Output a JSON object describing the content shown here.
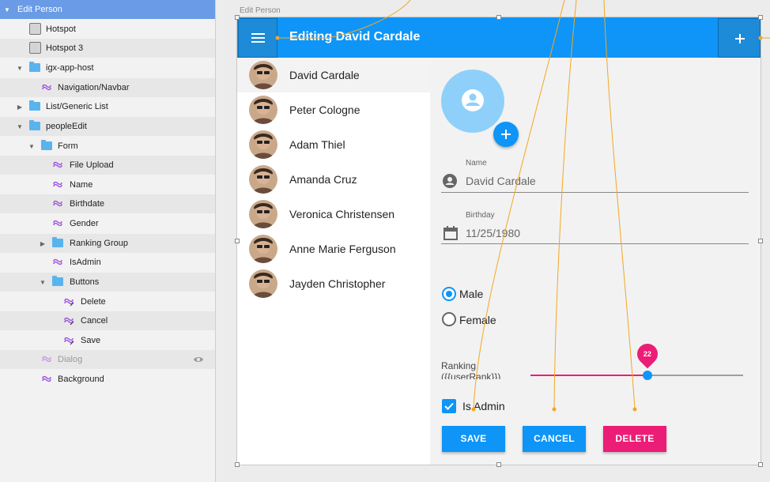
{
  "layers": {
    "items": [
      {
        "label": "Edit Person",
        "kind": "artboard",
        "indent": 0,
        "expanded": true,
        "selected": true
      },
      {
        "label": "Hotspot",
        "kind": "hotspot",
        "indent": 2
      },
      {
        "label": "Hotspot 3",
        "kind": "hotspot",
        "indent": 2
      },
      {
        "label": "igx-app-host",
        "kind": "folder",
        "indent": 1,
        "expanded": true
      },
      {
        "label": "Navigation/Navbar",
        "kind": "symbol",
        "indent": 2
      },
      {
        "label": "List/Generic List",
        "kind": "folder",
        "indent": 1,
        "expanded": false
      },
      {
        "label": "peopleEdit",
        "kind": "folder",
        "indent": 1,
        "expanded": true
      },
      {
        "label": "Form",
        "kind": "folder",
        "indent": 2,
        "expanded": true
      },
      {
        "label": "File Upload",
        "kind": "symbol",
        "indent": 3
      },
      {
        "label": "Name",
        "kind": "symbol",
        "indent": 3
      },
      {
        "label": "Birthdate",
        "kind": "symbol",
        "indent": 3
      },
      {
        "label": "Gender",
        "kind": "symbol",
        "indent": 3
      },
      {
        "label": "Ranking Group",
        "kind": "folder",
        "indent": 3,
        "expanded": false
      },
      {
        "label": "IsAdmin",
        "kind": "symbol",
        "indent": 3
      },
      {
        "label": "Buttons",
        "kind": "folder",
        "indent": 3,
        "expanded": true
      },
      {
        "label": "Delete",
        "kind": "symbol-link",
        "indent": 4
      },
      {
        "label": "Cancel",
        "kind": "symbol-link",
        "indent": 4
      },
      {
        "label": "Save",
        "kind": "symbol-link",
        "indent": 4
      },
      {
        "label": "Dialog",
        "kind": "symbol",
        "indent": 2,
        "hidden": true
      },
      {
        "label": "Background",
        "kind": "symbol",
        "indent": 2
      }
    ]
  },
  "canvas": {
    "artboard_title": "Edit Person",
    "appbar": {
      "title": "Editing David Cardale",
      "menu_icon": "hamburger-icon",
      "add_icon": "plus-icon"
    },
    "people": [
      "David Cardale",
      "Peter Cologne",
      "Adam Thiel",
      "Amanda Cruz",
      "Veronica Christensen",
      "Anne Marie Ferguson",
      "Jayden Christopher"
    ],
    "form": {
      "name_label": "Name",
      "name_value": "David Cardale",
      "birthday_label": "Birthday",
      "birthday_value": "11/25/1980",
      "gender_options": [
        "Male",
        "Female"
      ],
      "gender_selected": "Male",
      "ranking_label": "Ranking ({{userRank}})",
      "ranking_value": 22,
      "ranking_min": 0,
      "ranking_max": 40,
      "is_admin_label": "Is Admin",
      "is_admin": true,
      "save_label": "SAVE",
      "cancel_label": "CANCEL",
      "delete_label": "DELETE"
    }
  },
  "colors": {
    "primary": "#0e95f7",
    "accent": "#ec1d76",
    "wire": "#f5a623",
    "selection": "#6a9be6"
  }
}
